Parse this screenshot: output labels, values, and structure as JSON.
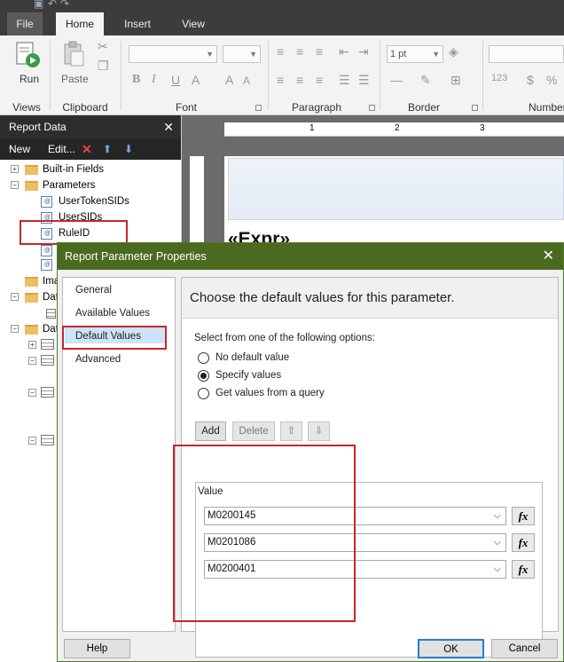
{
  "ribbon": {
    "tabs": [
      "File",
      "Home",
      "Insert",
      "View"
    ],
    "run_label": "Run",
    "paste_label": "Paste",
    "groups": [
      "Views",
      "Clipboard",
      "Font",
      "Paragraph",
      "Border",
      "Number"
    ],
    "border_width": "1 pt"
  },
  "report_data": {
    "title": "Report Data",
    "new_label": "New",
    "edit_label": "Edit...",
    "tree": {
      "built_in_fields": "Built-in Fields",
      "parameters": "Parameters",
      "params": [
        "UserTokenSIDs",
        "UserSIDs",
        "RuleID"
      ],
      "images_partial": "Ima",
      "data_sources_partial": "Dat",
      "datasets_partial": "Dat"
    }
  },
  "design": {
    "ruler_numbers": [
      "1",
      "2",
      "3"
    ],
    "expr_text": "«Expr»"
  },
  "dialog": {
    "title": "Report Parameter Properties",
    "nav": [
      "General",
      "Available Values",
      "Default Values",
      "Advanced"
    ],
    "selected_nav": "Default Values",
    "heading": "Choose the default values for this parameter.",
    "options_label": "Select from one of the following options:",
    "options": [
      "No default value",
      "Specify values",
      "Get values from a query"
    ],
    "selected_option": "Specify values",
    "buttons": {
      "add": "Add",
      "delete": "Delete"
    },
    "value_column": "Value",
    "values": [
      "M0200145",
      "M0201086",
      "M0200401"
    ],
    "fx_label": "fx",
    "footer": {
      "help": "Help",
      "ok": "OK",
      "cancel": "Cancel"
    }
  },
  "colors": {
    "dialog_title_bg": "#4a6b1f",
    "highlight_red": "#c8262b",
    "ok_border": "#2b7bd1"
  }
}
